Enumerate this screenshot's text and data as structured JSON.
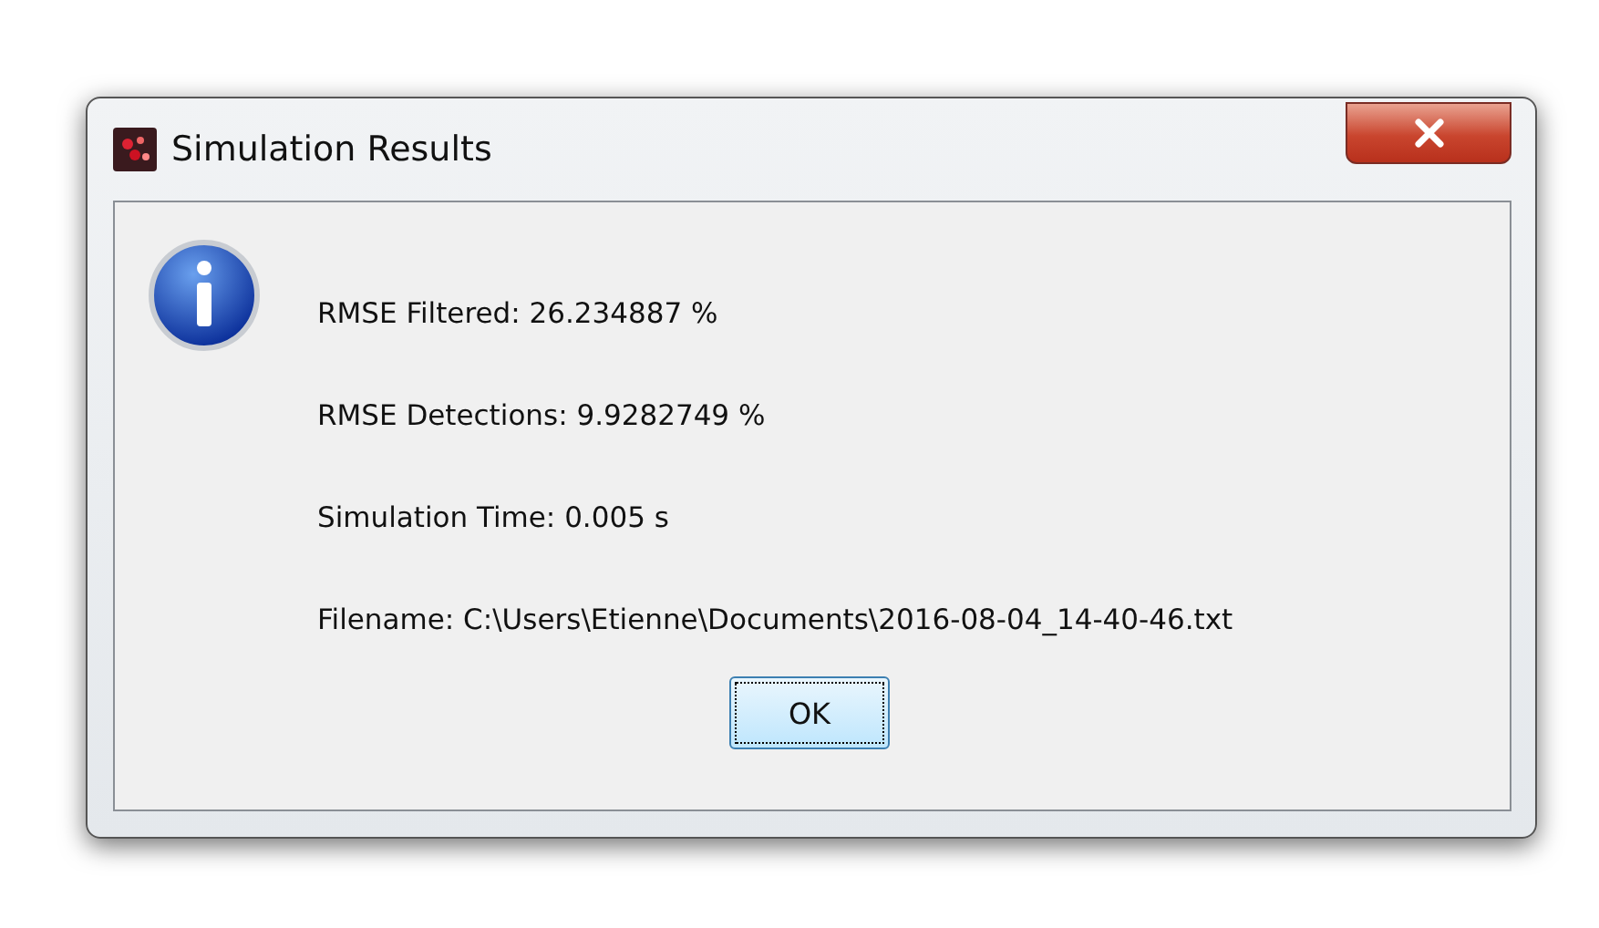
{
  "window": {
    "title": "Simulation Results"
  },
  "message_lines": [
    "RMSE Filtered: 26.234887 %",
    "RMSE Detections: 9.9282749 %",
    "Simulation Time: 0.005 s",
    "Filename: C:\\Users\\Etienne\\Documents\\2016-08-04_14-40-46.txt"
  ],
  "buttons": [
    {
      "label": "OK",
      "focused": true
    }
  ]
}
